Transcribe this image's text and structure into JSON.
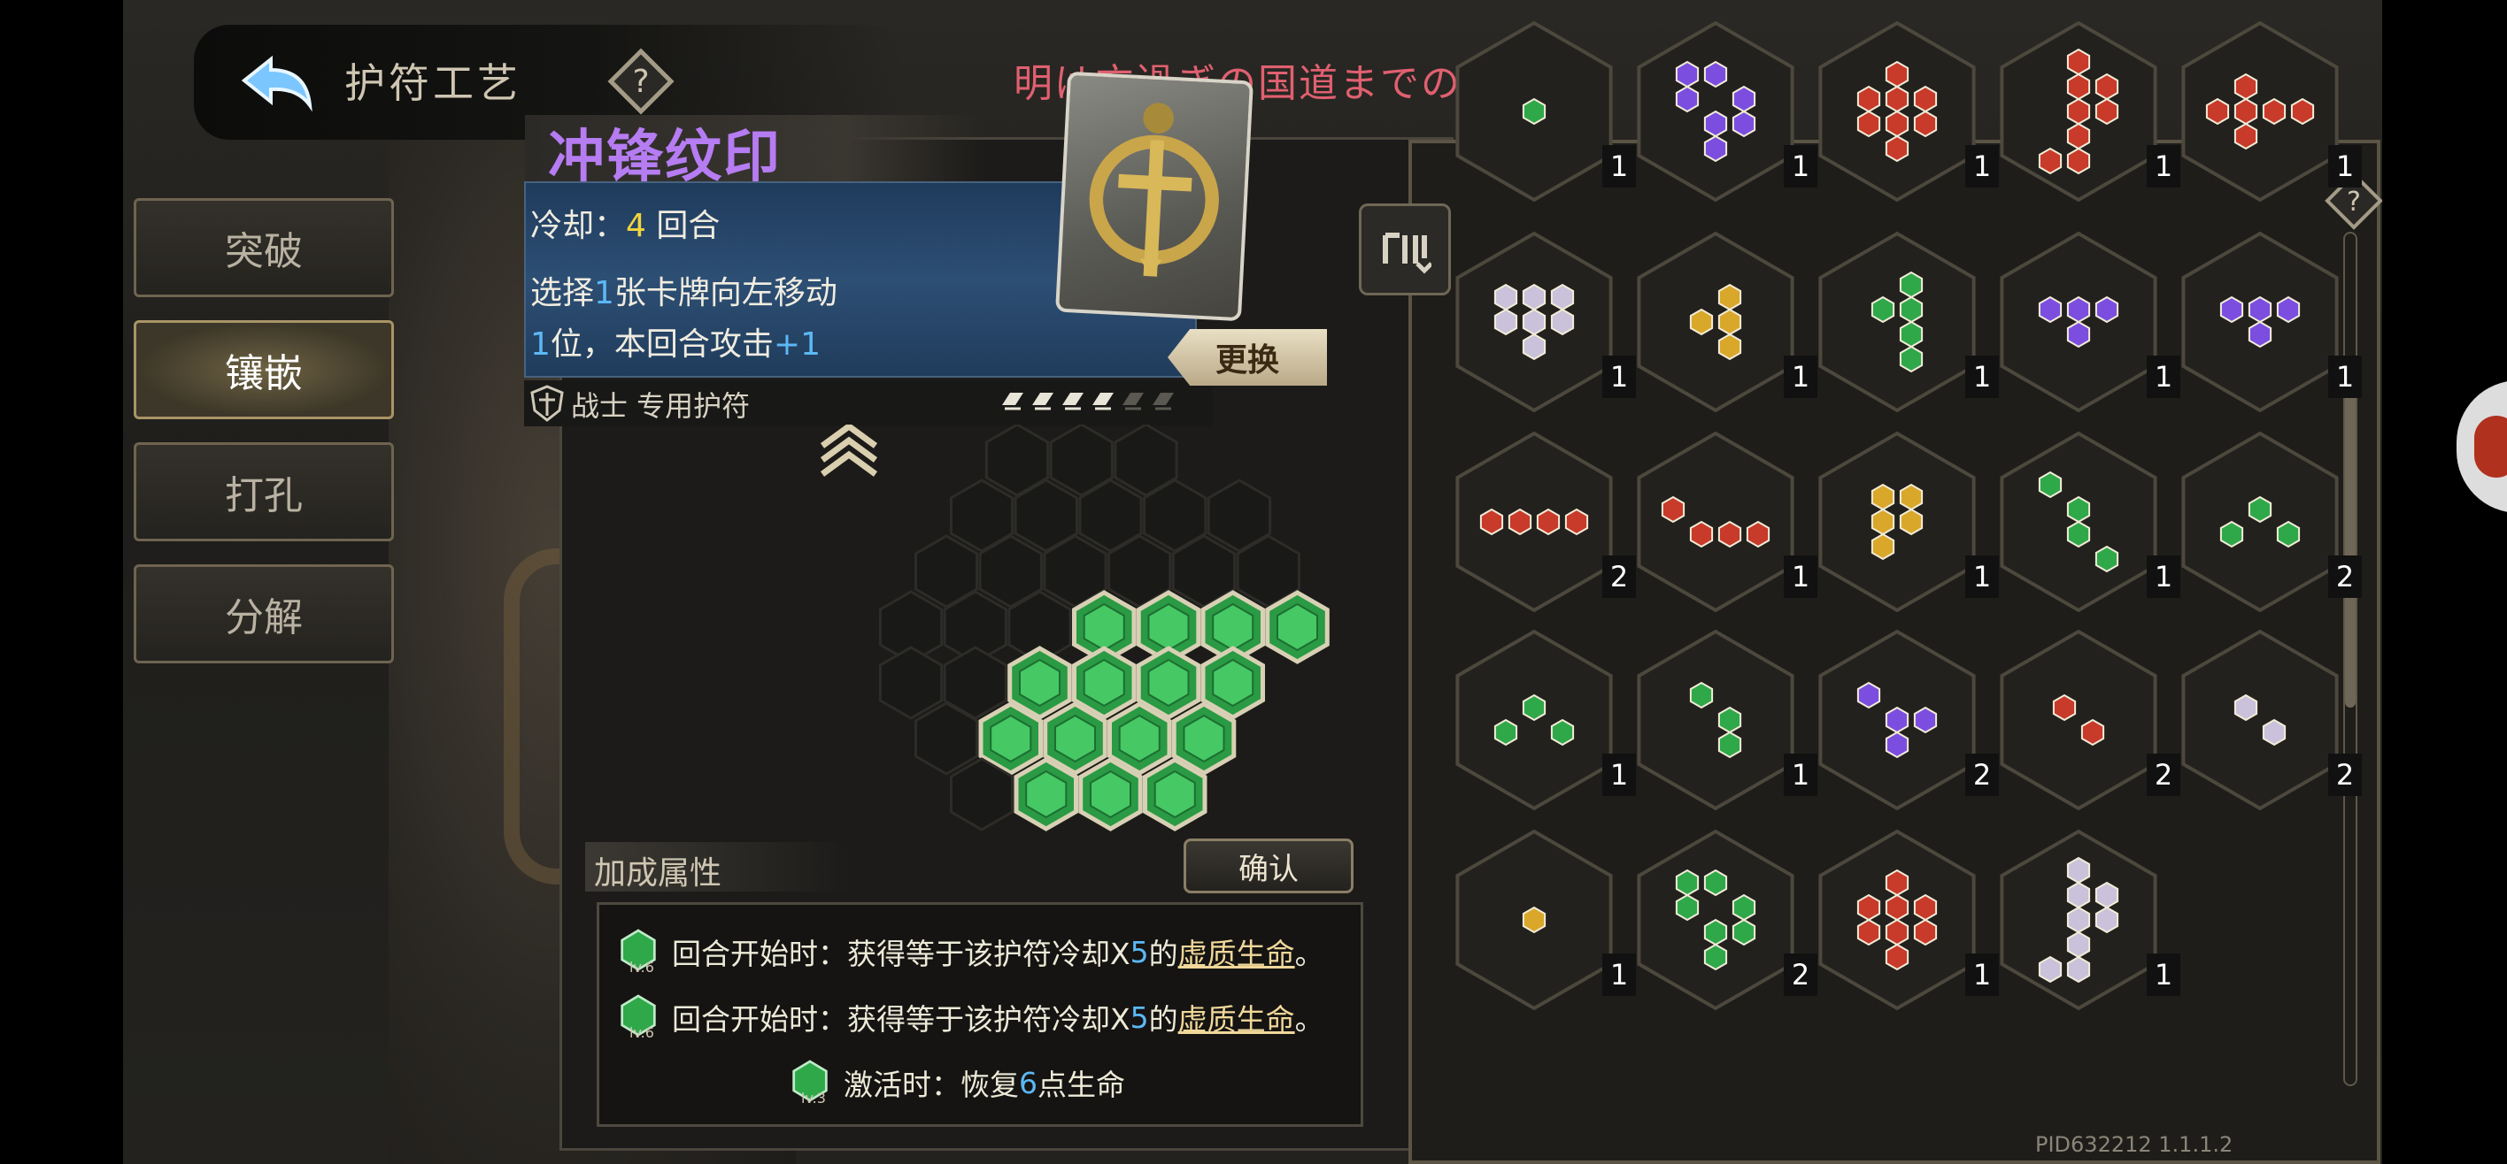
{
  "header": {
    "title": "护符工艺",
    "overlay_text": "明は方過ぎの国道までの"
  },
  "menu": {
    "items": [
      {
        "label": "突破"
      },
      {
        "label": "镶嵌",
        "active": true
      },
      {
        "label": "打孔"
      },
      {
        "label": "分解"
      }
    ]
  },
  "amulet": {
    "name": "冲锋纹印",
    "cooldown_label": "冷却：",
    "cooldown_value": "4",
    "cooldown_unit": "回合",
    "desc_line1_a": "选择",
    "desc_line1_num": "1",
    "desc_line1_b": "张卡牌向左移动",
    "desc_line2_num": "1",
    "desc_line2_a": "位，本回合攻击",
    "desc_line2_bonus": "+1",
    "class_label": "战士 专用护符",
    "rank_stars": 4,
    "rank_max": 6,
    "swap_label": "更换"
  },
  "bonus": {
    "title": "加成属性",
    "confirm_label": "确认",
    "rows": [
      {
        "level": "lv.6",
        "a": "回合开始时：获得等于该护符冷却X",
        "num": "5",
        "b": "的",
        "link": "虚质生命",
        "tail": "。"
      },
      {
        "level": "lv.6",
        "a": "回合开始时：获得等于该护符冷却X",
        "num": "5",
        "b": "的",
        "link": "虚质生命",
        "tail": "。"
      },
      {
        "level": "lv.3",
        "a": "激活时：恢复",
        "num": "6",
        "b": "点生命",
        "link": "",
        "tail": ""
      }
    ]
  },
  "colors": {
    "green": "#2fa84a",
    "yellow": "#d9a72a",
    "purple": "#7b4ee0",
    "red": "#c83a2a",
    "white": "#c9c2da"
  },
  "inventory": {
    "rows": [
      [
        {
          "color": "green",
          "count": "1"
        },
        {
          "color": "purple",
          "count": "1"
        },
        {
          "color": "red",
          "count": "1"
        },
        {
          "color": "red",
          "count": "1"
        },
        {
          "color": "red",
          "count": "1"
        }
      ],
      [
        {
          "color": "white",
          "count": "1"
        },
        {
          "color": "yellow",
          "count": "1"
        },
        {
          "color": "green",
          "count": "1"
        },
        {
          "color": "purple",
          "count": "1"
        },
        {
          "color": "purple",
          "count": "1"
        }
      ],
      [
        {
          "color": "red",
          "count": "2"
        },
        {
          "color": "red",
          "count": "1"
        },
        {
          "color": "yellow",
          "count": "1"
        },
        {
          "color": "green",
          "count": "1"
        },
        {
          "color": "green",
          "count": "2"
        }
      ],
      [
        {
          "color": "green",
          "count": "1"
        },
        {
          "color": "green",
          "count": "1"
        },
        {
          "color": "purple",
          "count": "2"
        },
        {
          "color": "red",
          "count": "2"
        },
        {
          "color": "white",
          "count": "2"
        }
      ],
      [
        {
          "color": "yellow",
          "count": "1"
        },
        {
          "color": "green",
          "count": "2"
        },
        {
          "color": "red",
          "count": "1"
        },
        {
          "color": "white",
          "count": "1"
        }
      ]
    ]
  },
  "version": "PID632212  1.1.1.2"
}
